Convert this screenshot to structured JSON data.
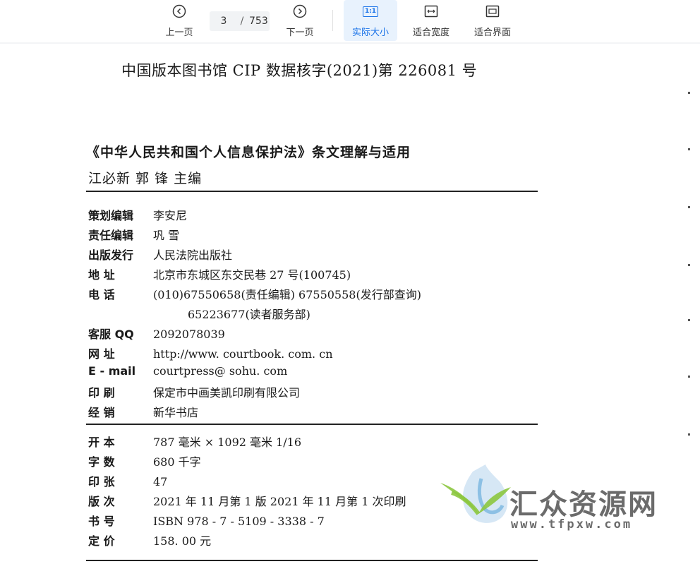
{
  "toolbar": {
    "prev_label": "上一页",
    "next_label": "下一页",
    "current_page": "3",
    "page_sep": "/",
    "total_pages": "753",
    "actual_size_label": "实际大小",
    "actual_size_icon_text": "1:1",
    "fit_width_label": "适合宽度",
    "fit_page_label": "适合界面",
    "accent": "#1a73e8"
  },
  "page": {
    "cip_line": "中国版本图书馆 CIP 数据核字(2021)第 226081 号",
    "book_title": "《中华人民共和国个人信息保护法》条文理解与适用",
    "authors": "江必新  郭  锋  主编",
    "info_rows": [
      {
        "key": "策划编辑",
        "value": "李安尼"
      },
      {
        "key": "责任编辑",
        "value": "巩  雪"
      },
      {
        "key": "出版发行",
        "value": "人民法院出版社"
      },
      {
        "key": "地    址",
        "value": "北京市东城区东交民巷 27 号(100745)"
      },
      {
        "key": "电    话",
        "value": "(010)67550658(责任编辑)  67550558(发行部查询)"
      },
      {
        "key": "客服 QQ",
        "value": "2092078039"
      },
      {
        "key": "网    址",
        "value": "http://www. courtbook. com. cn"
      },
      {
        "key": "E - mail",
        "value": "courtpress@ sohu. com"
      },
      {
        "key": "印    刷",
        "value": "保定市中画美凯印刷有限公司"
      },
      {
        "key": "经    销",
        "value": "新华书店"
      }
    ],
    "phone_cont": "65223677(读者服务部)",
    "spec_rows": [
      {
        "key": "开    本",
        "value": "787 毫米 × 1092 毫米   1/16"
      },
      {
        "key": "字    数",
        "value": "680 千字"
      },
      {
        "key": "印    张",
        "value": "47"
      },
      {
        "key": "版    次",
        "value": "2021 年 11 月第 1 版   2021 年 11 月第 1 次印刷"
      },
      {
        "key": "书    号",
        "value": "ISBN 978 - 7 - 5109 - 3338 - 7"
      },
      {
        "key": "定    价",
        "value": "158. 00 元"
      }
    ]
  },
  "watermark": {
    "text": "汇众资源网",
    "url": "www.tfpxw.com",
    "colors": {
      "leaf_green": "#8cc63f",
      "drop_blue": "#7fb8e0",
      "text_gray": "#6b6b6b"
    }
  }
}
